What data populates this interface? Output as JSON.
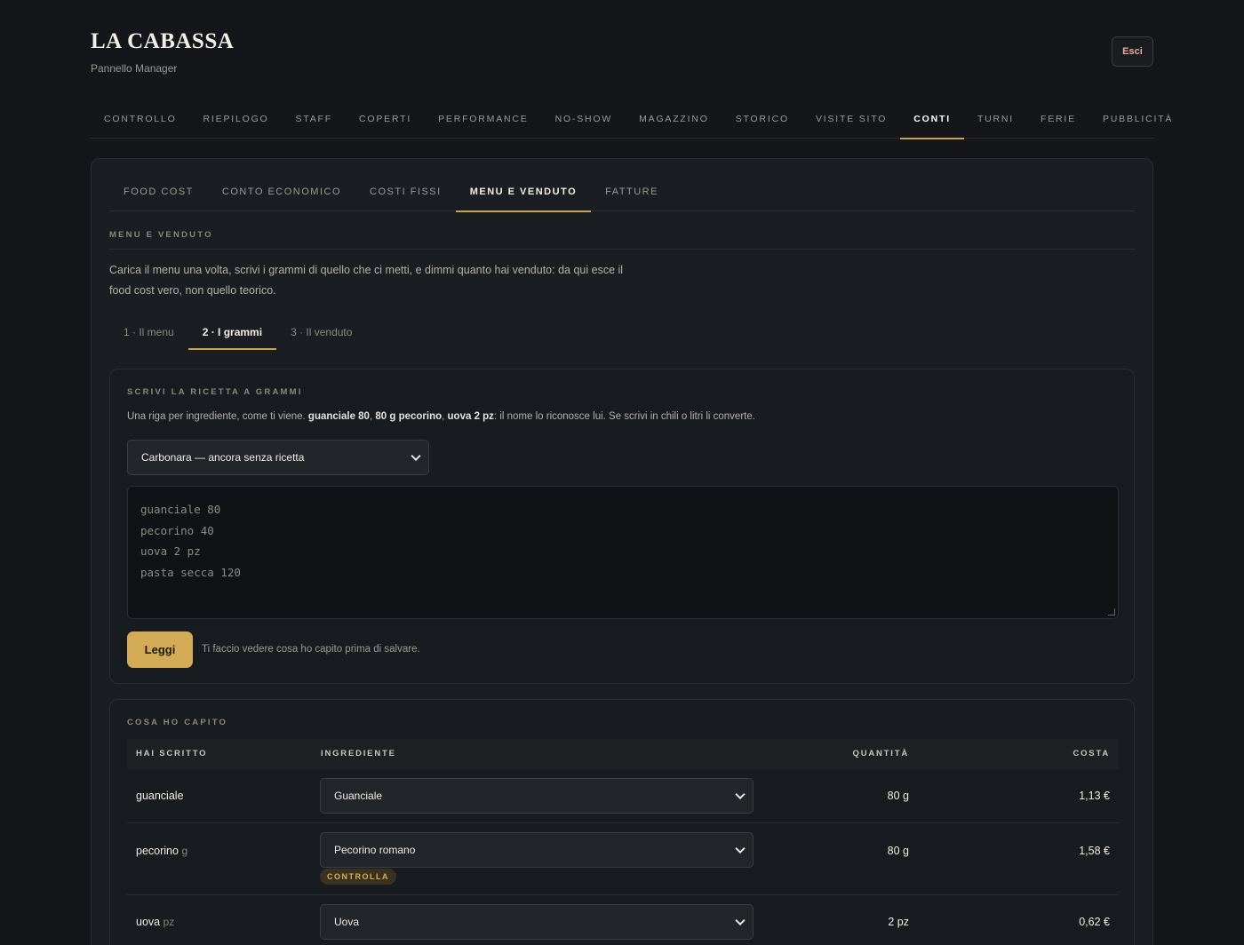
{
  "header": {
    "brand": "LA CABASSA",
    "subtitle": "Pannello Manager",
    "logout_label": "Esci"
  },
  "main_nav": [
    {
      "label": "CONTROLLO",
      "active": false
    },
    {
      "label": "RIEPILOGO",
      "active": false
    },
    {
      "label": "STAFF",
      "active": false
    },
    {
      "label": "COPERTI",
      "active": false
    },
    {
      "label": "PERFORMANCE",
      "active": false
    },
    {
      "label": "NO-SHOW",
      "active": false
    },
    {
      "label": "MAGAZZINO",
      "active": false
    },
    {
      "label": "STORICO",
      "active": false
    },
    {
      "label": "VISITE SITO",
      "active": false
    },
    {
      "label": "CONTI",
      "active": true
    },
    {
      "label": "TURNI",
      "active": false
    },
    {
      "label": "FERIE",
      "active": false
    },
    {
      "label": "PUBBLICITÀ",
      "active": false
    }
  ],
  "sub_nav": [
    {
      "label": "FOOD COST",
      "active": false
    },
    {
      "label": "CONTO ECONOMICO",
      "active": false
    },
    {
      "label": "COSTI FISSI",
      "active": false
    },
    {
      "label": "MENU E VENDUTO",
      "active": true
    },
    {
      "label": "FATTURE",
      "active": false
    }
  ],
  "section": {
    "title": "MENU E VENDUTO",
    "intro": "Carica il menu una volta, scrivi i grammi di quello che ci metti, e dimmi quanto hai venduto: da qui esce il food cost vero, non quello teorico."
  },
  "steps": [
    {
      "label": "1 · Il menu",
      "active": false
    },
    {
      "label": "2 · I grammi",
      "active": true
    },
    {
      "label": "3 · Il venduto",
      "active": false
    }
  ],
  "recipe": {
    "title": "SCRIVI LA RICETTA A GRAMMI",
    "hint_prefix": "Una riga per ingrediente, come ti viene. ",
    "hint_example_1": "guanciale 80",
    "hint_sep_1": ", ",
    "hint_example_2": "80 g pecorino",
    "hint_sep_2": ", ",
    "hint_example_3": "uova 2 pz",
    "hint_suffix": ": il nome lo riconosce lui. Se scrivi in chili o litri li converte.",
    "dish_selected": "Carbonara — ancora senza ricetta",
    "text_lines": [
      "guanciale 80",
      "pecorino 40",
      "uova 2 pz",
      "pasta secca 120"
    ],
    "read_button": "Leggi",
    "read_note": "Ti faccio vedere cosa ho capito prima di salvare."
  },
  "parsed": {
    "title": "COSA HO CAPITO",
    "columns": {
      "written": "HAI SCRITTO",
      "ingredient": "INGREDIENTE",
      "quantity": "QUANTITÀ",
      "cost": "COSTA"
    },
    "rows": [
      {
        "written": "guanciale",
        "unit": "",
        "ingredient": "Guanciale",
        "quantity": "80 g",
        "cost": "1,13 €",
        "badge": ""
      },
      {
        "written": "pecorino",
        "unit": "g",
        "ingredient": "Pecorino romano",
        "quantity": "80 g",
        "cost": "1,58 €",
        "badge": "CONTROLLA"
      },
      {
        "written": "uova",
        "unit": "pz",
        "ingredient": "Uova",
        "quantity": "2 pz",
        "cost": "0,62 €",
        "badge": ""
      }
    ]
  },
  "colors": {
    "background": "#14161a",
    "accent": "#c9a452",
    "button": "#d3aa55",
    "logout_text": "#e8a89c"
  }
}
